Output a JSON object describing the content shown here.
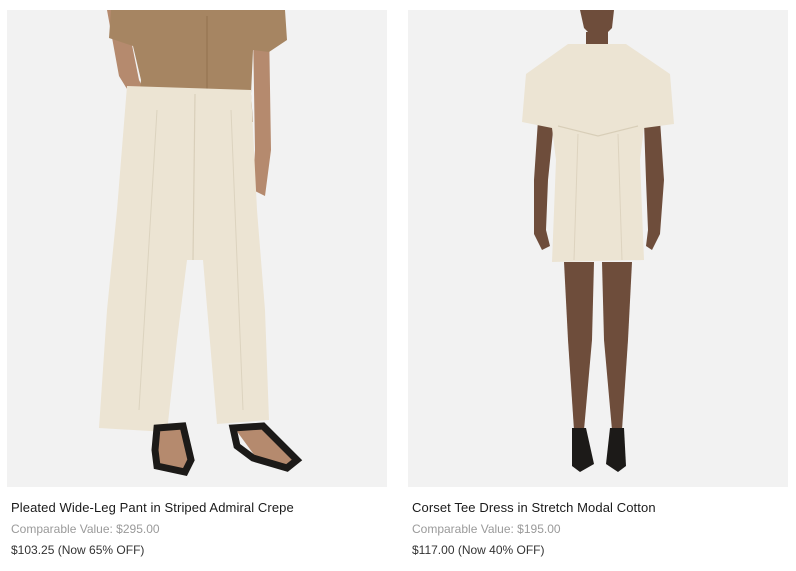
{
  "products": [
    {
      "name": "Pleated Wide-Leg Pant in Striped Admiral Crepe",
      "comparable_value": "Comparable Value: $295.00",
      "sale_price": "$103.25 (Now 65% OFF)",
      "image_alt": "pant-photo"
    },
    {
      "name": "Corset Tee Dress in Stretch Modal Cotton",
      "comparable_value": "Comparable Value: $195.00",
      "sale_price": "$117.00 (Now 40% OFF)",
      "image_alt": "dress-photo"
    }
  ],
  "colors": {
    "photo_bg": "#f2f2f2",
    "cream": "#ece4d3",
    "top_brown": "#a68562",
    "skin": "#b58a6e",
    "skin_dark": "#6e4d3b",
    "shoe": "#1c1a18",
    "comparable_text": "#9a9a9a",
    "name_text": "#1a1a1a"
  }
}
